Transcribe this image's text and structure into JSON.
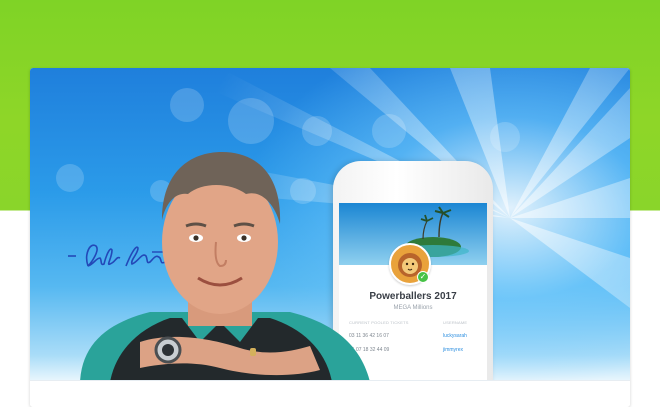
{
  "app": {
    "pool_name": "Powerballers 2017",
    "pool_subtitle": "MEGA Millions",
    "column_headers": [
      "CURRENT POOLED TICKETS",
      "USERNAME"
    ],
    "ticket_rows": [
      {
        "numbers": "03  11  36  42  16  07",
        "user": "luckysarah"
      },
      {
        "numbers": "01  07  18  32  44  09",
        "user": "jimmyrex"
      }
    ]
  },
  "colors": {
    "green": "#8ad52a",
    "sky_blue": "#2b9be9",
    "link_blue": "#2d8fe0"
  },
  "icons": [
    "signature",
    "check-icon",
    "close-icon",
    "lion-avatar-icon"
  ]
}
